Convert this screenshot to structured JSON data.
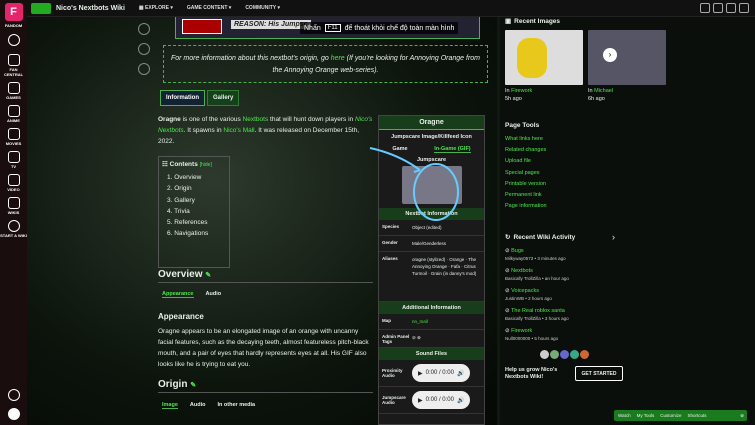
{
  "rail": {
    "items": [
      {
        "label": "FANDOM",
        "icon": "fandom-logo-icon"
      },
      {
        "label": "FAN CENTRAL",
        "icon": "fan-central-icon"
      },
      {
        "label": "GAMES",
        "icon": "games-icon"
      },
      {
        "label": "ANIME",
        "icon": "anime-icon"
      },
      {
        "label": "MOVIES",
        "icon": "movies-icon"
      },
      {
        "label": "TV",
        "icon": "tv-icon"
      },
      {
        "label": "VIDEO",
        "icon": "video-icon"
      },
      {
        "label": "WIKIS",
        "icon": "wikis-icon"
      },
      {
        "label": "START A WIKI",
        "icon": "plus-icon"
      }
    ]
  },
  "topbar": {
    "wiki_name": "Nico's Nextbots Wiki",
    "nav": [
      "EXPLORE",
      "GAME CONTENT",
      "COMMUNITY"
    ]
  },
  "banner": {
    "reason": "REASON: His Jumpsc"
  },
  "toast": {
    "pre": "Nhấn",
    "key": "F11",
    "post": "để thoát khỏi chế độ toàn màn hình"
  },
  "info_note": {
    "a": "For more information about this nextbot's origin, go ",
    "link1": "here",
    "b": " (If you're looking for Annoying Orange from the Annoying Orange web-series)."
  },
  "article": {
    "tabs": [
      "Information",
      "Gallery"
    ],
    "intro": {
      "name": "Oragne",
      "t1": " is one of the various ",
      "l1": "Nextbots",
      "t2": " that will hunt down players in ",
      "l2": "Nico's Nextbots",
      "t3": ". It spawns in ",
      "l3": "Nico's Mall",
      "t4": ". It was released on December 15th, 2022."
    },
    "toc": {
      "title": "Contents",
      "hide": "[hide]",
      "items": [
        "1.  Overview",
        "2.  Origin",
        "3.  Gallery",
        "4.  Trivia",
        "5.  References",
        "6.  Navigations"
      ]
    },
    "overview": {
      "title": "Overview",
      "tabs": [
        "Appearance",
        "Audio"
      ]
    },
    "appearance": {
      "title": "Appearance",
      "text": "Oragne appears to be an elongated image of an orange with uncanny facial features, such as the decaying teeth, almost featureless pitch-black mouth, and a pair of eyes that hardly represents eyes at all. His GIF also looks like he is trying to eat you."
    },
    "origin": {
      "title": "Origin",
      "tabs": [
        "Image",
        "Audio",
        "In other media"
      ]
    }
  },
  "infobox": {
    "title": "Oragne",
    "sub": "Jumpscare Image/Killfeed Icon",
    "tabs": [
      "Game",
      "In-Game (GIF)"
    ],
    "img_label": "Jumpscare",
    "sec1": "Nextbot Information",
    "rows": [
      {
        "k": "Species",
        "v": "Object (edited)"
      },
      {
        "k": "Gender",
        "v": "Male/Genderless"
      },
      {
        "k": "Aliases",
        "v": "oragne (stylized) · Orange · The Annoying Orange · Fafa · Citrus Turmoil · Grain (in danny's mod)"
      }
    ],
    "sec2": "Additional Information",
    "rows2": [
      {
        "k": "Map",
        "v": "nn_mall"
      },
      {
        "k": "Admin Panel Tags",
        "v": ""
      }
    ],
    "sec3": "Sound Files",
    "audio": [
      {
        "k": "Proximity Audio",
        "time": "0:00 / 0:00"
      },
      {
        "k": "Jumpscare Audio",
        "time": "0:00 / 0:00"
      }
    ]
  },
  "right": {
    "recent_images": "Recent Images",
    "images": [
      {
        "title": "Firework",
        "time": "5h ago"
      },
      {
        "title": "Michael",
        "time": "6h ago"
      }
    ],
    "wiki_tools_title": "Page Tools",
    "tools": [
      "What links here",
      "Related changes",
      "Upload file",
      "Special pages",
      "Printable version",
      "Permanent link",
      "Page information"
    ],
    "activity_title": "Recent Wiki Activity",
    "activity": [
      {
        "title": "Bugs",
        "meta": "Milkyway0573 • 3 minutes ago"
      },
      {
        "title": "Nextbots",
        "meta": "Basically TrollZilla • an hour ago"
      },
      {
        "title": "Voicepacks",
        "meta": "JustinWB • 2 hours ago"
      },
      {
        "title": "The Real roblox santa",
        "meta": "Basically TrollZilla • 3 hours ago"
      },
      {
        "title": "Firework",
        "meta": "Null0000000 • 5 hours ago"
      }
    ],
    "help_text": "Help us grow Nico's Nextbots Wiki!",
    "start_button": "GET STARTED"
  },
  "footer": {
    "items": [
      "Watch",
      "My Tools",
      "Customize",
      "Shortcuts"
    ]
  },
  "colors": {
    "accent": "#4ce64c",
    "rail": "#1a0d0d",
    "infobox_header": "#173d1b"
  }
}
